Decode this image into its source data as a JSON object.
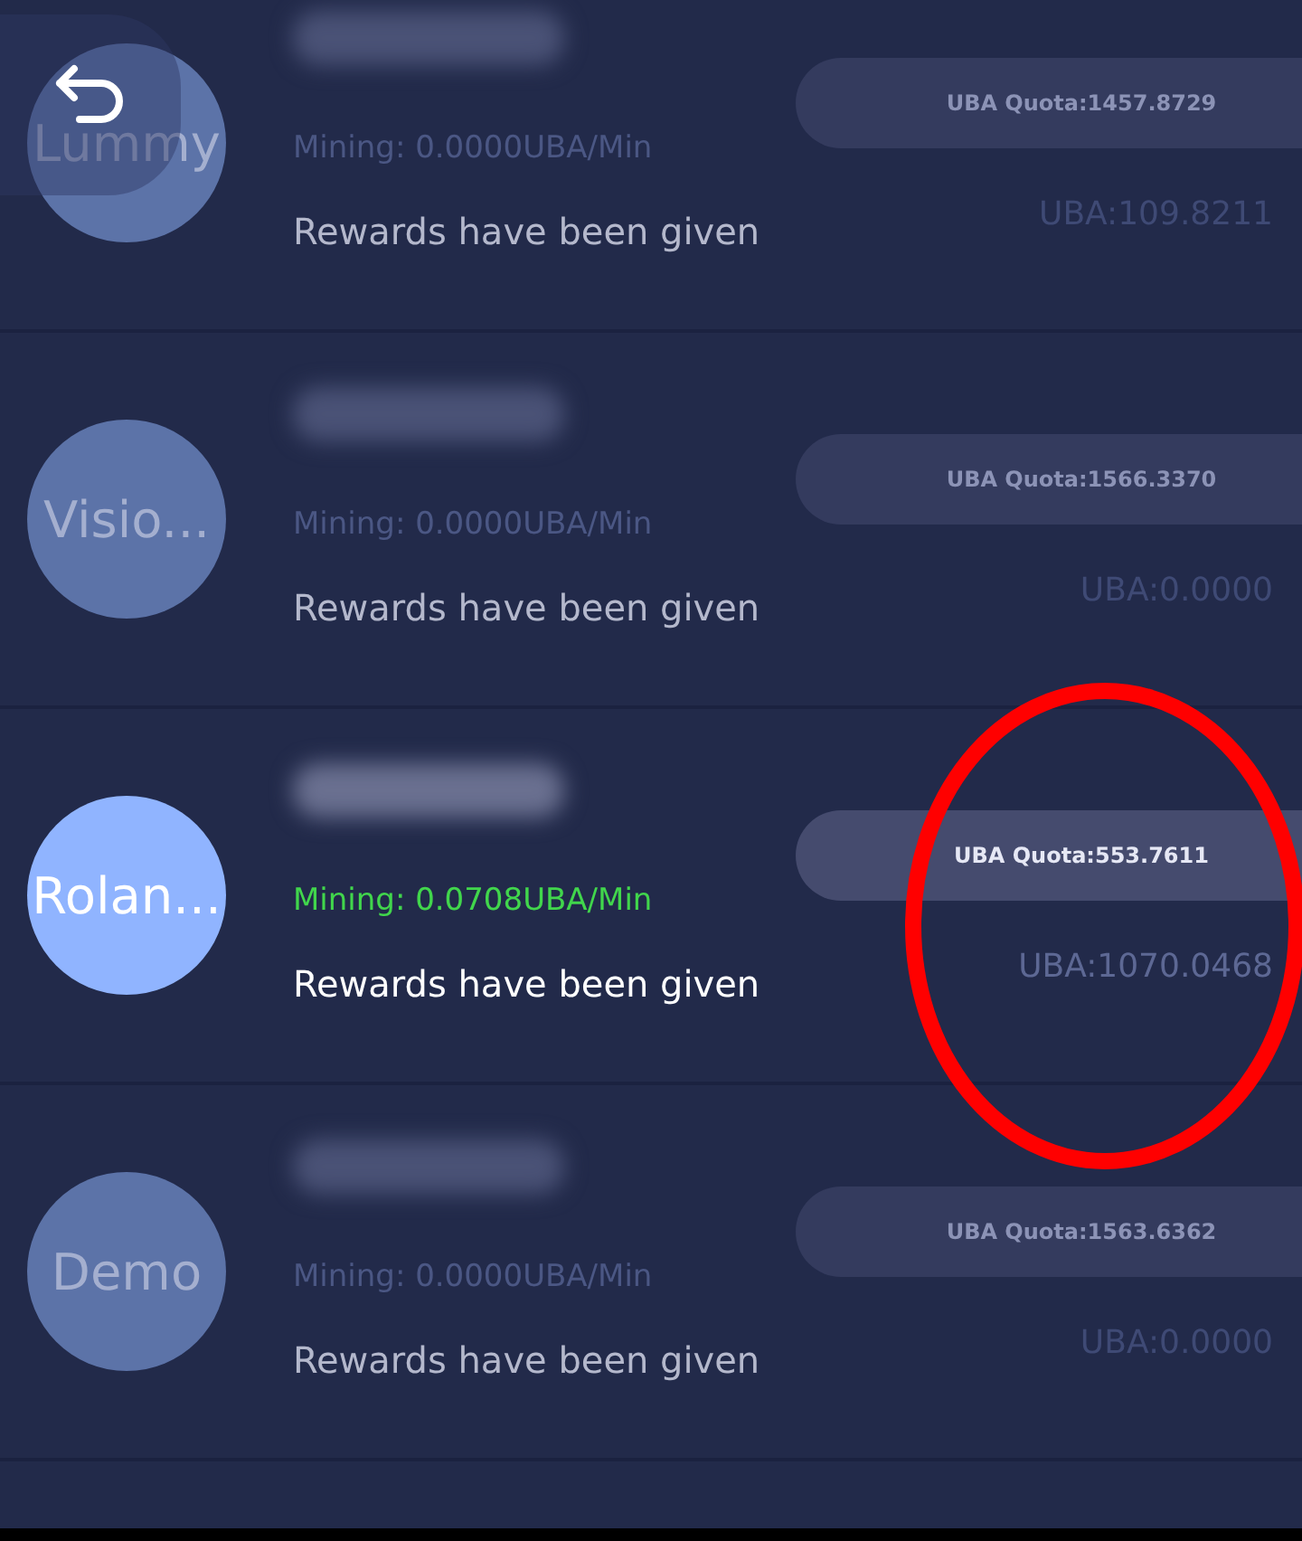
{
  "rows": [
    {
      "avatar_label": "Lummy",
      "active": false,
      "mining": "Mining: 0.0000UBA/Min",
      "status": "Rewards have been given",
      "quota": "UBA Quota:1457.8729",
      "balance": "UBA:109.8211"
    },
    {
      "avatar_label": "Visio...",
      "active": false,
      "mining": "Mining: 0.0000UBA/Min",
      "status": "Rewards have been given",
      "quota": "UBA Quota:1566.3370",
      "balance": "UBA:0.0000"
    },
    {
      "avatar_label": "Rolan...",
      "active": true,
      "mining": "Mining: 0.0708UBA/Min",
      "status": "Rewards have been given",
      "quota": "UBA Quota:553.7611",
      "balance": "UBA:1070.0468"
    },
    {
      "avatar_label": "Demo",
      "active": false,
      "mining": "Mining: 0.0000UBA/Min",
      "status": "Rewards have been given",
      "quota": "UBA Quota:1563.6362",
      "balance": "UBA:0.0000"
    }
  ],
  "annotation": {
    "kind": "ellipse",
    "color": "#ff0000"
  }
}
